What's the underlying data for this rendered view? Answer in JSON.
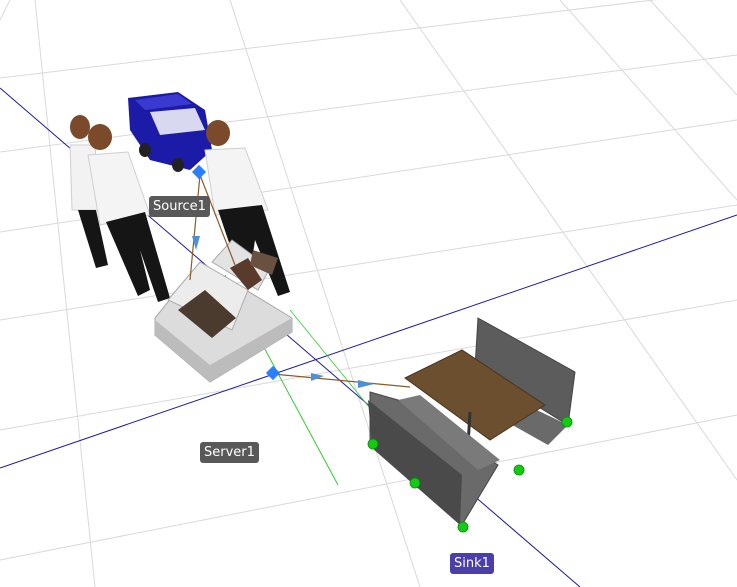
{
  "scene": {
    "background": "#ffffff",
    "grid_color": "#d8d8d8",
    "axis_x_color": "#1a1aa8",
    "axis_z_color": "#33cc33"
  },
  "objects": {
    "source": {
      "name": "Source1",
      "label_color": "#595959"
    },
    "server": {
      "name": "Server1",
      "label_color": "#595959"
    },
    "sink": {
      "name": "Sink1",
      "label_color": "#4a3fa8"
    }
  },
  "colors": {
    "node_blue": "#2a7fff",
    "node_green": "#11cc11",
    "path_line": "#8a5a2a",
    "arrow_blue": "#4f8fd6",
    "vehicle": "#1b1ba8",
    "table_top": "#6b4f2e",
    "sofa": "#505050"
  }
}
